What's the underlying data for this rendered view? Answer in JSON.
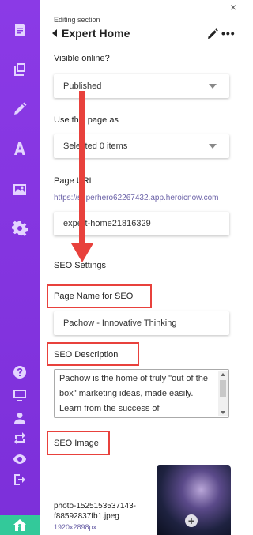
{
  "header": {
    "editing_label": "Editing section",
    "title": "Expert Home",
    "close_glyph": "×",
    "more_glyph": "•••"
  },
  "visible_online": {
    "label": "Visible online?",
    "value": "Published"
  },
  "use_page_as": {
    "label": "Use this page as",
    "value": "Selected 0 items"
  },
  "page_url": {
    "label": "Page URL",
    "url": "https://superhero62267432.app.heroicnow.com",
    "slug": "expert-home21816329"
  },
  "seo": {
    "section_label": "SEO Settings",
    "page_name_label": "Page Name for SEO",
    "page_name_value": "Pachow - Innovative Thinking",
    "description_label": "SEO Description",
    "description_value": "Pachow is the home of truly \"out of the box\" marketing ideas, made easily. Learn from the success of",
    "image_label": "SEO Image",
    "image_filename": "photo-1525153537143-f88592837fb1.jpeg",
    "image_dims": "1920x2898px"
  },
  "rail_icons": [
    "document-icon",
    "copy-icon",
    "pencil-icon",
    "font-icon",
    "image-icon",
    "settings-icon",
    "help-icon",
    "monitor-icon",
    "user-icon",
    "sync-icon",
    "eye-icon",
    "logout-icon",
    "home-icon"
  ],
  "colors": {
    "rail": "#8b3ae6",
    "home_button": "#33c99a",
    "highlight": "#e8413c",
    "link": "#6c63a8"
  }
}
